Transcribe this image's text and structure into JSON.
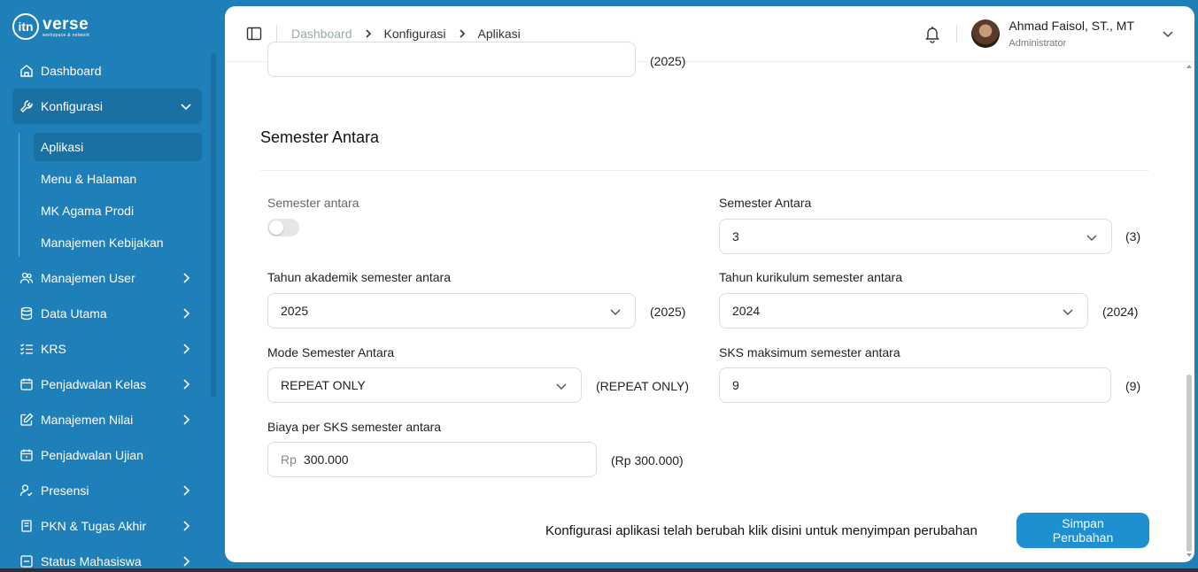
{
  "brand": {
    "logo_mark": "itn",
    "name": "verse",
    "tagline": "workspace & network"
  },
  "sidebar": {
    "items": [
      {
        "label": "Dashboard",
        "icon": "home-icon"
      },
      {
        "label": "Konfigurasi",
        "icon": "wrench-icon",
        "expanded": true,
        "children": [
          "Aplikasi",
          "Menu & Halaman",
          "MK Agama Prodi",
          "Manajemen Kebijakan"
        ],
        "active_child": "Aplikasi"
      },
      {
        "label": "Manajemen User",
        "icon": "users-icon"
      },
      {
        "label": "Data Utama",
        "icon": "database-icon"
      },
      {
        "label": "KRS",
        "icon": "list-check-icon"
      },
      {
        "label": "Penjadwalan Kelas",
        "icon": "calendar-icon"
      },
      {
        "label": "Manajemen Nilai",
        "icon": "edit-icon"
      },
      {
        "label": "Penjadwalan Ujian",
        "icon": "calendar-icon"
      },
      {
        "label": "Presensi",
        "icon": "user-check-icon"
      },
      {
        "label": "PKN & Tugas Akhir",
        "icon": "book-icon"
      },
      {
        "label": "Status Mahasiswa",
        "icon": "status-icon"
      }
    ]
  },
  "breadcrumb": [
    "Dashboard",
    "Konfigurasi",
    "Aplikasi"
  ],
  "user": {
    "name": "Ahmad Faisol, ST., MT",
    "role": "Administrator"
  },
  "prev_suffix": "(2025)",
  "section": {
    "title": "Semester Antara"
  },
  "fields": {
    "semester_antara_toggle": {
      "label": "Semester antara",
      "value": false
    },
    "semester_antara": {
      "label": "Semester Antara",
      "value": "3",
      "suffix": "(3)"
    },
    "tahun_akademik": {
      "label": "Tahun akademik semester antara",
      "value": "2025",
      "suffix": "(2025)"
    },
    "tahun_kurikulum": {
      "label": "Tahun kurikulum semester antara",
      "value": "2024",
      "suffix": "(2024)"
    },
    "mode": {
      "label": "Mode Semester Antara",
      "value": "REPEAT ONLY",
      "suffix": "(REPEAT ONLY)"
    },
    "sks_maks": {
      "label": "SKS maksimum semester antara",
      "value": "9",
      "suffix": "(9)"
    },
    "biaya": {
      "label": "Biaya per SKS semester antara",
      "prefix": "Rp",
      "value": "300.000",
      "suffix": "(Rp 300.000)"
    }
  },
  "footer": {
    "message": "Konfigurasi aplikasi telah berubah klik disini untuk menyimpan perubahan",
    "save_label": "Simpan Perubahan"
  },
  "colors": {
    "sidebar": "#1f7fb8",
    "active": "#1a6fa3",
    "button": "#1e8fd1"
  }
}
